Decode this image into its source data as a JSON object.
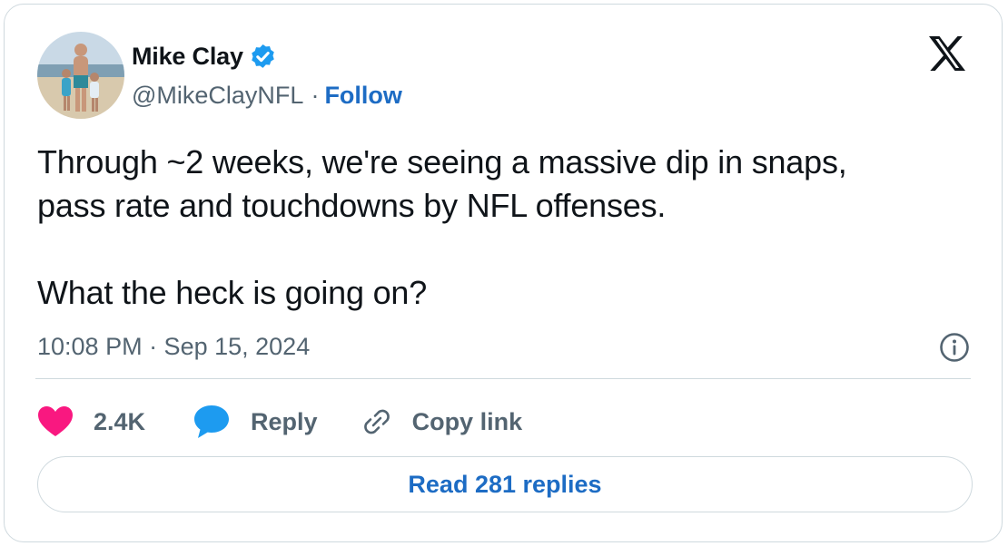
{
  "author": {
    "display_name": "Mike Clay",
    "handle": "@MikeClayNFL",
    "separator": "·",
    "follow_label": "Follow",
    "verified": true
  },
  "tweet": {
    "lines": [
      "Through ~2 weeks, we're seeing a massive dip in snaps,",
      "pass rate and touchdowns by NFL offenses.",
      "What the heck is going on?"
    ],
    "timestamp": "10:08 PM · Sep 15, 2024"
  },
  "actions": {
    "like_count": "2.4K",
    "reply_label": "Reply",
    "copy_link_label": "Copy link"
  },
  "read_replies_label": "Read 281 replies",
  "icons": {
    "brand": "x-logo-icon",
    "verified": "verified-badge-icon",
    "like": "heart-icon",
    "reply": "speech-bubble-icon",
    "copy": "link-icon",
    "info": "info-icon"
  },
  "colors": {
    "accent": "#1d6cc4",
    "verified": "#1d9bf0",
    "like": "#f91880",
    "muted": "#536471",
    "border": "#cfd9de"
  }
}
